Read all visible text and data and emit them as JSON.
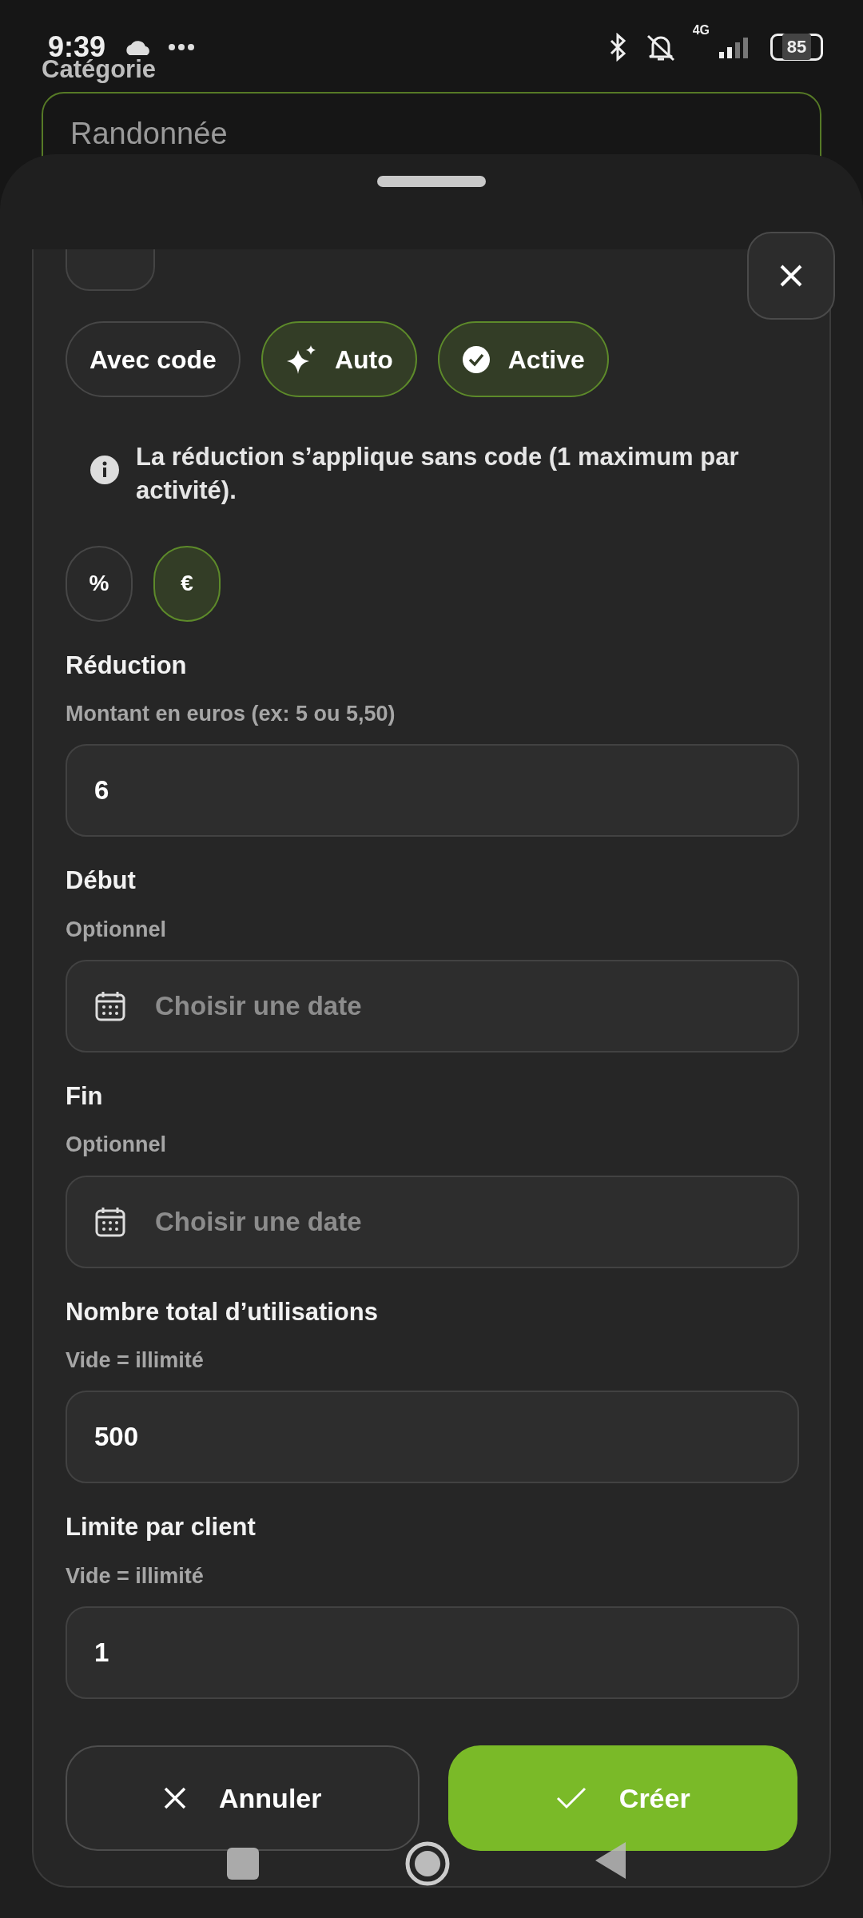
{
  "status_bar": {
    "time": "9:39",
    "battery": "85",
    "network": "4G"
  },
  "background_form": {
    "label": "Catégorie",
    "value": "Randonnée"
  },
  "mode_chips": [
    {
      "label": "Avec code",
      "kind": "plain",
      "selected": false
    },
    {
      "label": "Auto",
      "kind": "auto",
      "selected": true
    },
    {
      "label": "Active",
      "kind": "status",
      "selected": true
    }
  ],
  "info": "La réduction s’applique sans code (1 maximum par activité).",
  "unit_toggles": [
    {
      "label": "%",
      "selected": false
    },
    {
      "label": "€",
      "selected": true
    }
  ],
  "fields": [
    {
      "kind": "text",
      "label": "Réduction",
      "hint": "Montant en euros (ex: 5 ou 5,50)",
      "value": "6"
    },
    {
      "kind": "date",
      "label": "Début",
      "hint": "Optionnel",
      "placeholder": "Choisir une date"
    },
    {
      "kind": "date",
      "label": "Fin",
      "hint": "Optionnel",
      "placeholder": "Choisir une date"
    },
    {
      "kind": "text",
      "label": "Nombre total d’utilisations",
      "hint": "Vide = illimité",
      "value": "500"
    },
    {
      "kind": "text",
      "label": "Limite par client",
      "hint": "Vide = illimité",
      "value": "1"
    }
  ],
  "actions": [
    {
      "label": "Annuler",
      "kind": "cancel"
    },
    {
      "label": "Créer",
      "kind": "primary"
    }
  ]
}
